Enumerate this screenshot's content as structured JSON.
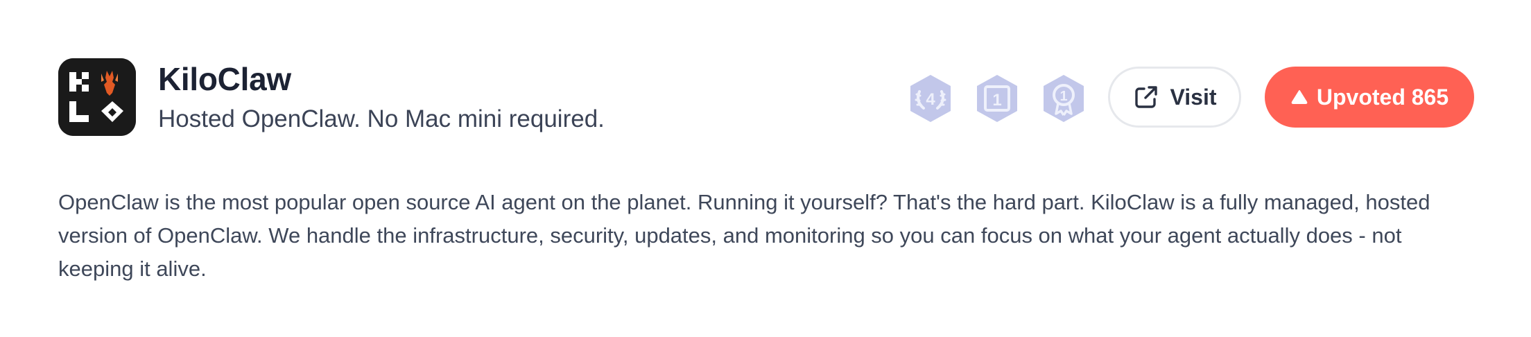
{
  "product": {
    "name": "KiloClaw",
    "tagline": "Hosted OpenClaw. No Mac mini required.",
    "logo_icon": "kiloclaw-logo-icon",
    "description": "OpenClaw is the most popular open source AI agent on the planet. Running it yourself? That's the hard part. KiloClaw is a fully managed, hosted version of OpenClaw. We handle the infrastructure, security, updates, and monitoring so you can focus on what your agent actually does - not keeping it alive."
  },
  "badges": [
    {
      "icon": "laurel-rank-badge-icon",
      "label": "4"
    },
    {
      "icon": "day-rank-badge-icon",
      "label": "1"
    },
    {
      "icon": "ribbon-rank-badge-icon",
      "label": "1"
    }
  ],
  "actions": {
    "visit_label": "Visit",
    "visit_icon": "external-link-icon",
    "upvote_label": "Upvoted 865",
    "upvote_icon": "upvote-triangle-icon"
  },
  "colors": {
    "accent": "#ff6154",
    "badge": "#c2c7ea",
    "badge_text": "#eef0fb",
    "text_primary": "#1c2233",
    "text_secondary": "#3e4759"
  }
}
